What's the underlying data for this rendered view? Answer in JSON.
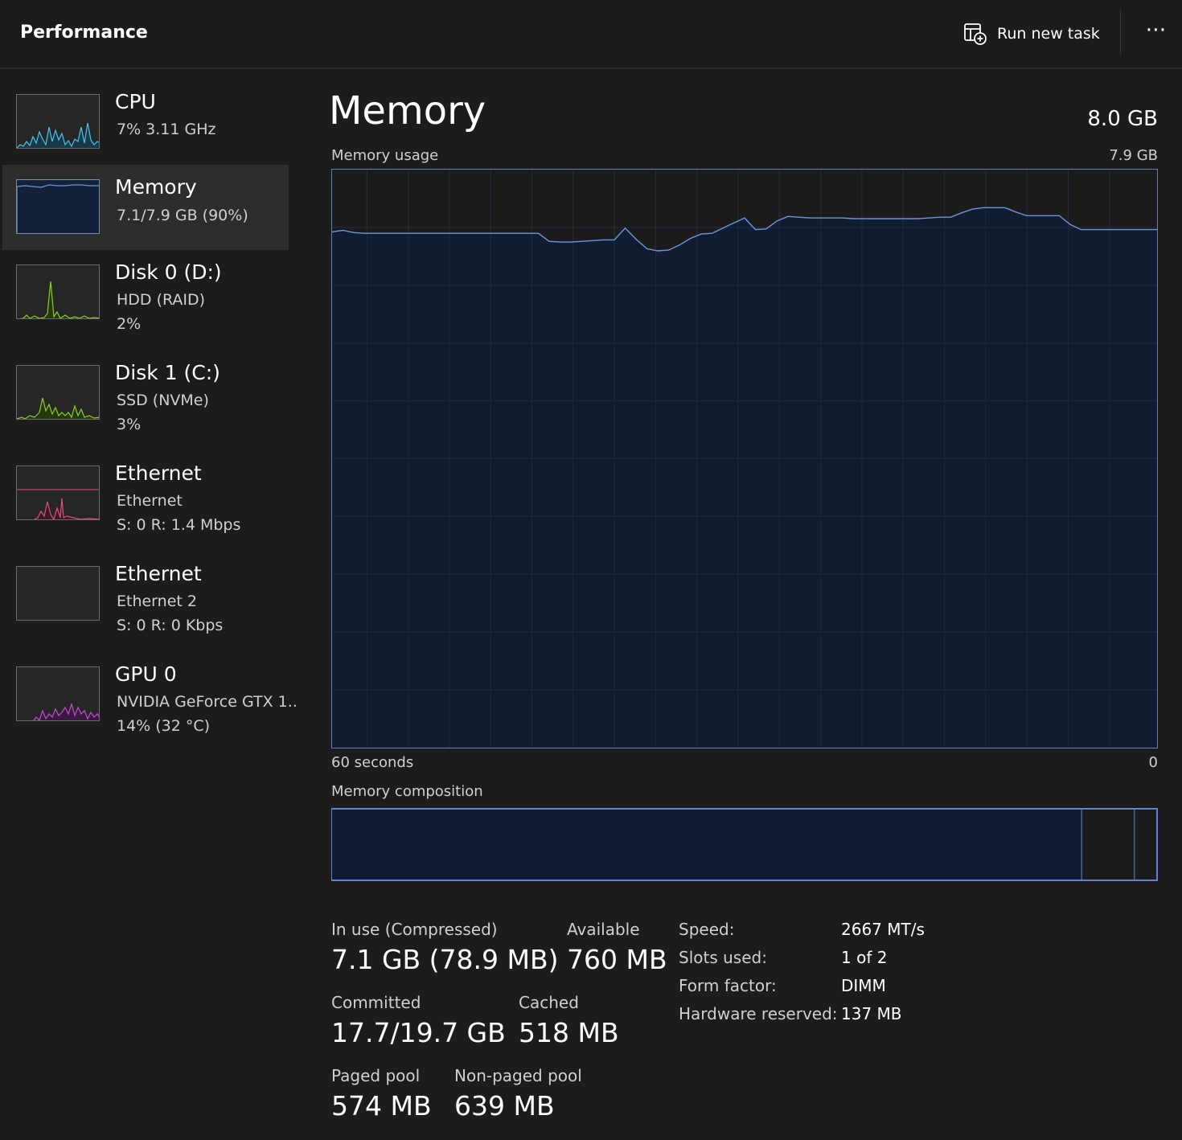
{
  "header": {
    "title": "Performance",
    "run_task_label": "Run new task",
    "more_label": "⋯"
  },
  "sidebar": {
    "items": [
      {
        "name": "CPU",
        "line1": "7%  3.11 GHz",
        "line2": "",
        "color": "#4cc2e6"
      },
      {
        "name": "Memory",
        "line1": "7.1/7.9 GB (90%)",
        "line2": "",
        "color": "#6d95d9"
      },
      {
        "name": "Disk 0 (D:)",
        "line1": "HDD (RAID)",
        "line2": "2%",
        "color": "#8fcc2e"
      },
      {
        "name": "Disk 1 (C:)",
        "line1": "SSD (NVMe)",
        "line2": "3%",
        "color": "#8fcc2e"
      },
      {
        "name": "Ethernet",
        "line1": "Ethernet",
        "line2": "S: 0  R: 1.4 Mbps",
        "color": "#e0507a"
      },
      {
        "name": "Ethernet",
        "line1": "Ethernet 2",
        "line2": "S: 0  R: 0 Kbps",
        "color": "#e0507a"
      },
      {
        "name": "GPU 0",
        "line1": "NVIDIA GeForce GTX 1..",
        "line2": "14%  (32 °C)",
        "color": "#c04fd0"
      }
    ]
  },
  "main": {
    "title": "Memory",
    "total": "8.0 GB",
    "usage_label": "Memory usage",
    "usage_max": "7.9 GB",
    "time_left": "60 seconds",
    "time_right": "0",
    "composition_label": "Memory composition",
    "composition": {
      "in_use_fraction": 0.909,
      "modified_fraction": 0.064,
      "standby_fraction": 0.026
    },
    "stats": {
      "in_use_label": "In use (Compressed)",
      "in_use_value": "7.1 GB (78.9 MB)",
      "available_label": "Available",
      "available_value": "760 MB",
      "committed_label": "Committed",
      "committed_value": "17.7/19.7 GB",
      "cached_label": "Cached",
      "cached_value": "518 MB",
      "paged_label": "Paged pool",
      "paged_value": "574 MB",
      "nonpaged_label": "Non-paged pool",
      "nonpaged_value": "639 MB"
    },
    "properties": [
      {
        "label": "Speed:",
        "value": "2667 MT/s"
      },
      {
        "label": "Slots used:",
        "value": "1 of 2"
      },
      {
        "label": "Form factor:",
        "value": "DIMM"
      },
      {
        "label": "Hardware reserved:",
        "value": "137 MB"
      }
    ]
  },
  "chart_data": {
    "type": "area",
    "xlabel": "",
    "ylabel": "",
    "x_range_seconds": [
      60,
      0
    ],
    "ylim": [
      0,
      7.9
    ],
    "grid": true,
    "usage_gb": [
      7.05,
      7.07,
      7.04,
      7.03,
      7.03,
      7.03,
      7.03,
      7.03,
      7.03,
      7.03,
      7.03,
      7.03,
      7.03,
      7.03,
      7.03,
      7.03,
      7.03,
      7.03,
      7.03,
      7.03,
      6.92,
      6.91,
      6.91,
      6.92,
      6.93,
      6.94,
      6.94,
      7.1,
      6.95,
      6.82,
      6.79,
      6.8,
      6.87,
      6.96,
      7.02,
      7.03,
      7.1,
      7.17,
      7.24,
      7.08,
      7.09,
      7.2,
      7.26,
      7.25,
      7.24,
      7.24,
      7.24,
      7.24,
      7.23,
      7.23,
      7.23,
      7.23,
      7.23,
      7.23,
      7.23,
      7.24,
      7.25,
      7.25,
      7.31,
      7.36,
      7.38,
      7.38,
      7.38,
      7.32,
      7.27,
      7.27,
      7.27,
      7.27,
      7.15,
      7.08,
      7.08,
      7.08,
      7.08,
      7.08,
      7.08,
      7.08,
      7.08
    ],
    "series_color": "#6d95d9"
  }
}
